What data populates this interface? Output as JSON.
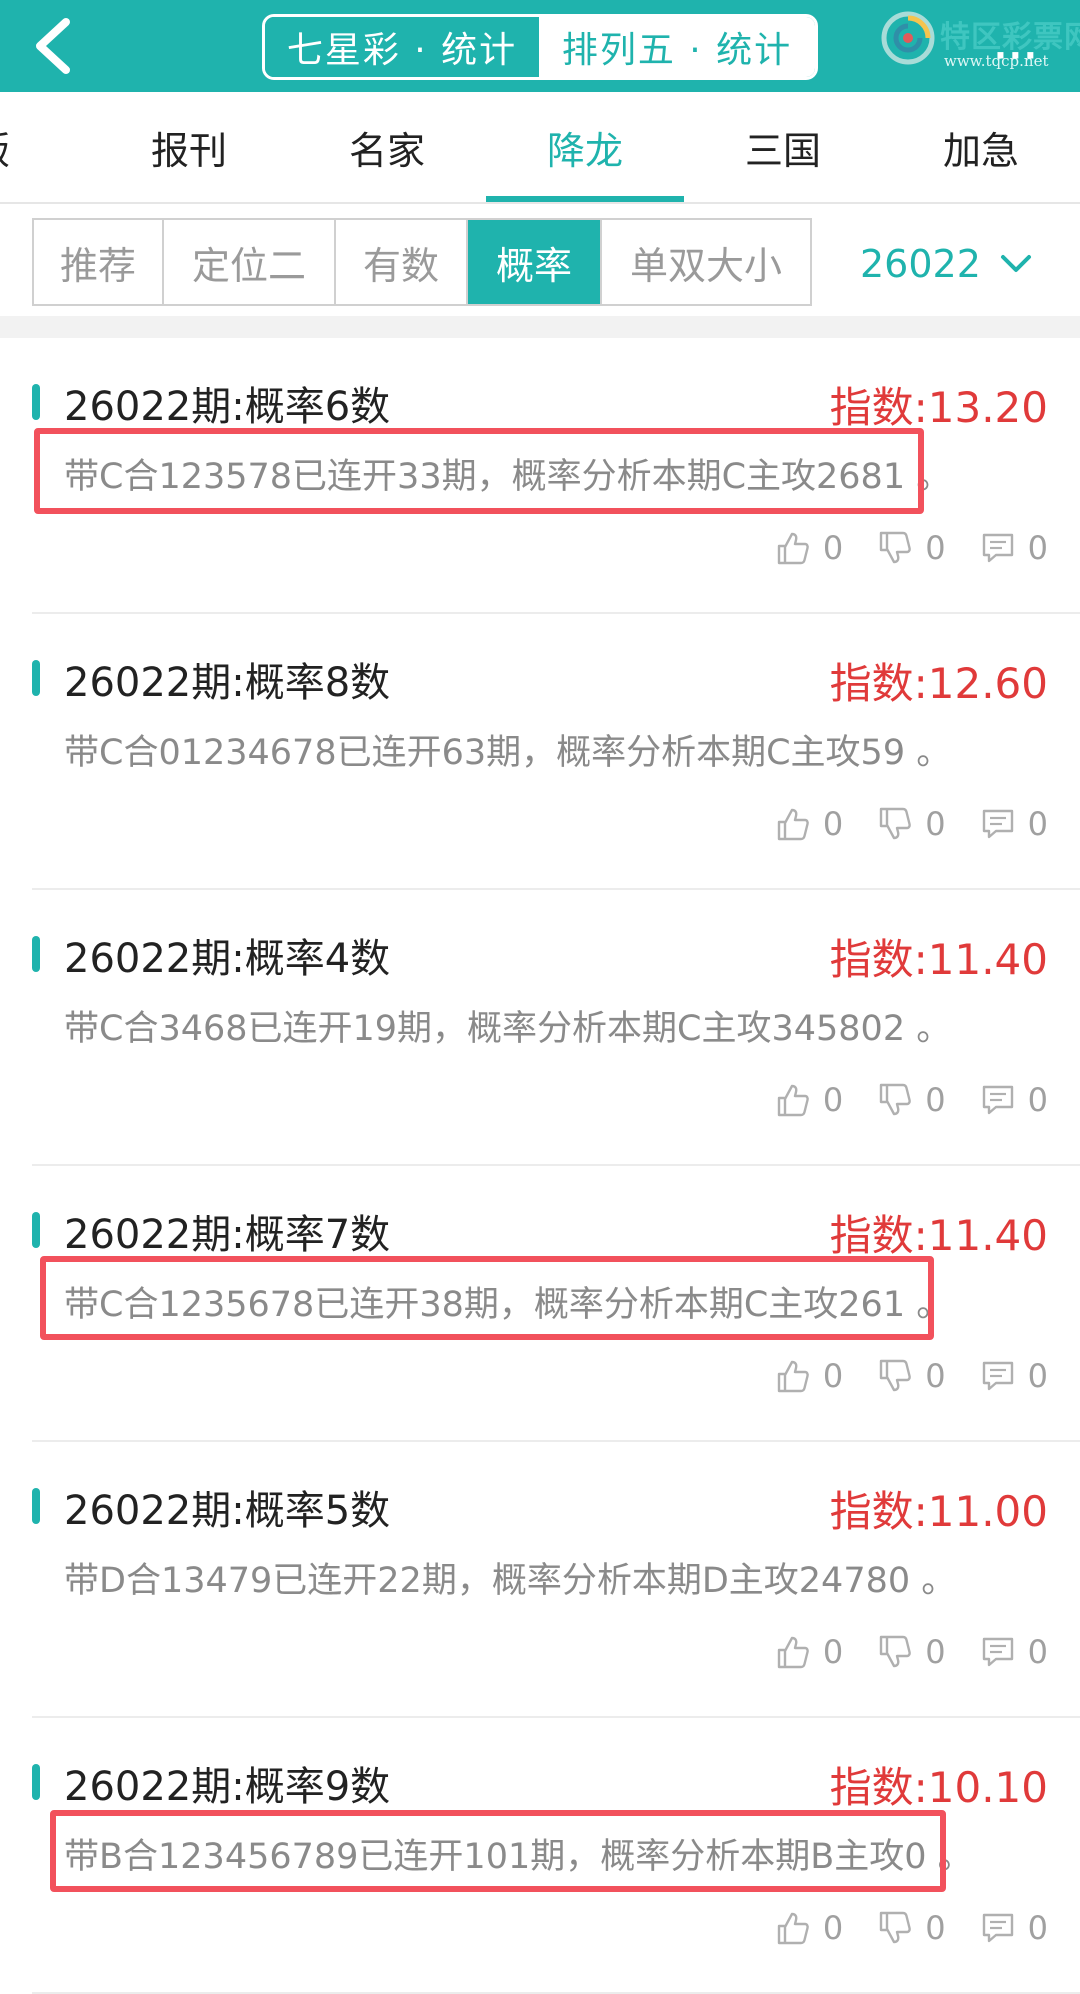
{
  "header": {
    "seg_active": "七星彩 · 统计",
    "seg_inactive": "排列五 · 统计",
    "brand_name": "特区彩票网",
    "brand_url": "www.tqcp.net",
    "more": "···"
  },
  "categories": [
    "版",
    "报刊",
    "名家",
    "降龙",
    "三国",
    "加急"
  ],
  "active_category": "降龙",
  "filters": [
    "推荐",
    "定位二",
    "有数",
    "概率",
    "单双大小"
  ],
  "active_filter": "概率",
  "period": "26022",
  "colors": {
    "accent": "#1fb3ad",
    "index_red": "#e03a3a",
    "highlight": "#f2515c"
  },
  "items": [
    {
      "title": "26022期:概率6数",
      "index": "指数:13.20",
      "desc": "带C合123578已连开33期，概率分析本期C主攻2681 。",
      "likes": "0",
      "dislikes": "0",
      "comments": "0"
    },
    {
      "title": "26022期:概率8数",
      "index": "指数:12.60",
      "desc": "带C合01234678已连开63期，概率分析本期C主攻59 。",
      "likes": "0",
      "dislikes": "0",
      "comments": "0"
    },
    {
      "title": "26022期:概率4数",
      "index": "指数:11.40",
      "desc": "带C合3468已连开19期，概率分析本期C主攻345802 。",
      "likes": "0",
      "dislikes": "0",
      "comments": "0"
    },
    {
      "title": "26022期:概率7数",
      "index": "指数:11.40",
      "desc": "带C合1235678已连开38期，概率分析本期C主攻261 。",
      "likes": "0",
      "dislikes": "0",
      "comments": "0"
    },
    {
      "title": "26022期:概率5数",
      "index": "指数:11.00",
      "desc": "带D合13479已连开22期，概率分析本期D主攻24780 。",
      "likes": "0",
      "dislikes": "0",
      "comments": "0"
    },
    {
      "title": "26022期:概率9数",
      "index": "指数:10.10",
      "desc": "带B合123456789已连开101期，概率分析本期B主攻0 。",
      "likes": "0",
      "dislikes": "0",
      "comments": "0"
    }
  ]
}
